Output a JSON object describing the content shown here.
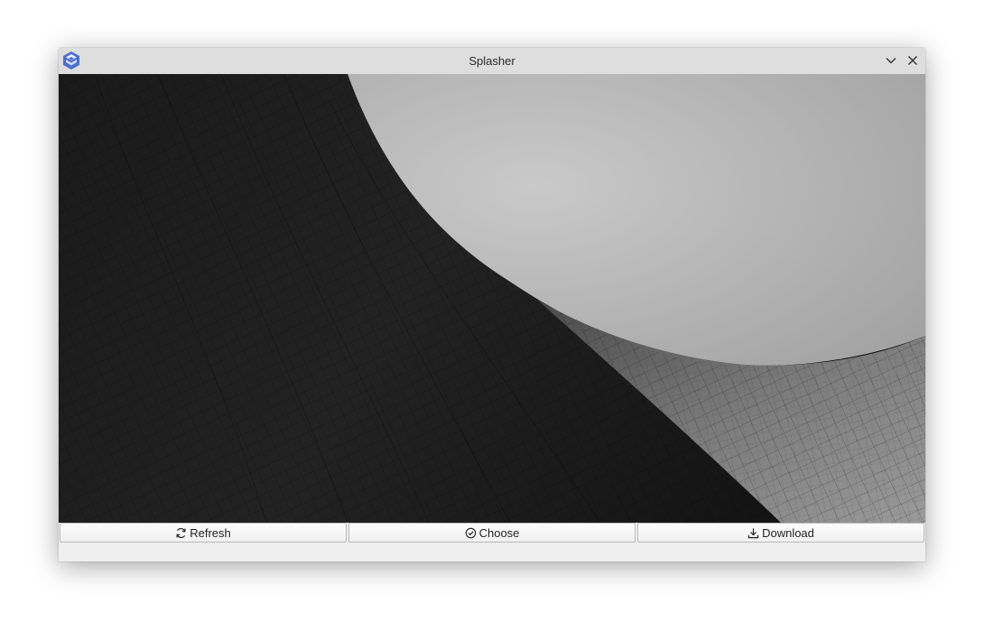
{
  "window": {
    "title": "Splasher",
    "app_icon": "splasher-logo-icon",
    "controls": [
      "minimize-chevron-icon",
      "close-icon"
    ]
  },
  "photo": {
    "description_icon": "cooling-tower-photo"
  },
  "toolbar": {
    "refresh_label": "Refresh",
    "choose_label": "Choose",
    "download_label": "Download"
  },
  "colors": {
    "titlebar": "#dedede",
    "window_bg": "#efefef",
    "logo": "#4a6fd1"
  }
}
